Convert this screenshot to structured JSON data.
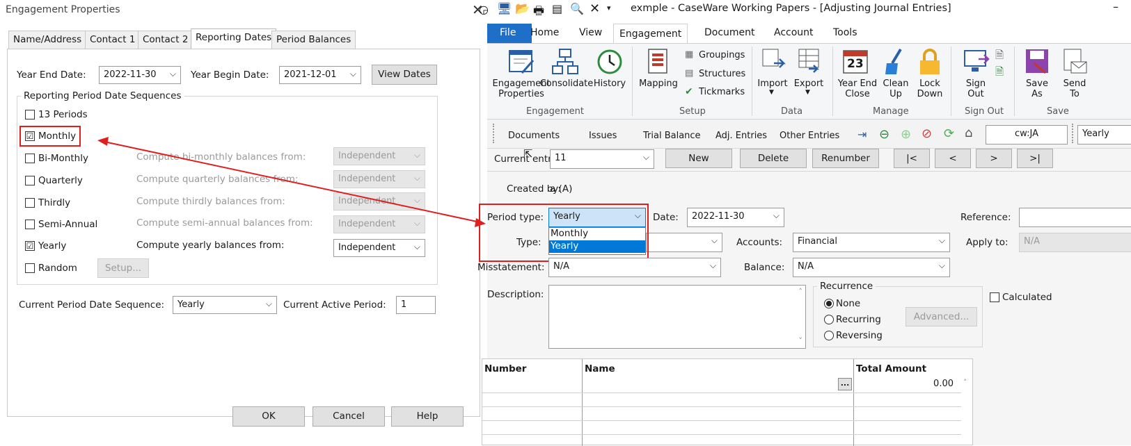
{
  "dialog": {
    "title": "Engagement Properties",
    "close_icon": "close-icon",
    "tabs": [
      "Name/Address",
      "Contact 1",
      "Contact 2",
      "Reporting Dates",
      "Period Balances"
    ],
    "active_tab": "Reporting Dates",
    "year_end_label": "Year End Date:",
    "year_end_value": "2022-11-30",
    "year_begin_label": "Year Begin Date:",
    "year_begin_value": "2021-12-01",
    "view_dates_button": "View Dates",
    "group_title": "Reporting Period Date Sequences",
    "periods": [
      {
        "label": "13 Periods",
        "checked": false
      },
      {
        "label": "Monthly",
        "checked": true
      },
      {
        "label": "Bi-Monthly",
        "checked": false,
        "compute": "Compute bi-monthly balances from:",
        "value": "Independent",
        "enabled": false
      },
      {
        "label": "Quarterly",
        "checked": false,
        "compute": "Compute quarterly balances from:",
        "value": "Independent",
        "enabled": false
      },
      {
        "label": "Thirdly",
        "checked": false,
        "compute": "Compute thirdly balances from:",
        "value": "Independent",
        "enabled": false
      },
      {
        "label": "Semi-Annual",
        "checked": false,
        "compute": "Compute semi-annual balances from:",
        "value": "Independent",
        "enabled": false
      },
      {
        "label": "Yearly",
        "checked": true,
        "compute": "Compute yearly balances from:",
        "value": "Independent",
        "enabled": true
      },
      {
        "label": "Random",
        "checked": false
      }
    ],
    "setup_button": "Setup...",
    "current_seq_label": "Current Period Date Sequence:",
    "current_seq_value": "Yearly",
    "current_active_label": "Current Active Period:",
    "current_active_value": "1",
    "ok_button": "OK",
    "cancel_button": "Cancel",
    "help_button": "Help",
    "check_mark": "☑"
  },
  "app": {
    "title": "exmple - CaseWare Working Papers - [Adjusting Journal Entries]",
    "minimize": "–",
    "ribbon_tabs": [
      "File",
      "Home",
      "View",
      "Engagement",
      "Document",
      "Account",
      "Tools"
    ],
    "active_ribbon_tab": "Engagement",
    "ribbon": {
      "engagement_properties": "Engagement Properties",
      "consolidate": "Consolidate",
      "history": "History",
      "engagement_group": "Engagement",
      "mapping": "Mapping",
      "groupings": "Groupings",
      "structures": "Structures",
      "tickmarks": "Tickmarks",
      "setup_group": "Setup",
      "import": "Import",
      "export": "Export",
      "data_group": "Data",
      "year_end_close": "Year End Close",
      "clean_up": "Clean Up",
      "lock_down": "Lock Down",
      "manage_group": "Manage",
      "sign_out": "Sign Out",
      "sign_out_group": "Sign Out",
      "save_as": "Save As",
      "send_to": "Send To",
      "save_group": "Save",
      "calendar_day": "23"
    },
    "nav": [
      "Documents",
      "Issues",
      "Trial Balance",
      "Adj. Entries",
      "Other Entries"
    ],
    "nav_search": "cw:JA",
    "nav_period": "Yearly",
    "form": {
      "current_entry_label": "Current entry:",
      "current_entry_value": "11",
      "new_button": "New",
      "delete_button": "Delete",
      "renumber_button": "Renumber",
      "first_button": "|<",
      "prev_button": "<",
      "next_button": ">",
      "last_button": ">|",
      "created_by_label": "Created by:",
      "created_by_value": "a (A)",
      "period_type_label": "Period type:",
      "period_type_value": "Yearly",
      "period_options": [
        "Monthly",
        "Yearly"
      ],
      "date_label": "Date:",
      "date_value": "2022-11-30",
      "reference_label": "Reference:",
      "type_label": "Type:",
      "accounts_label": "Accounts:",
      "accounts_value": "Financial",
      "apply_to_label": "Apply to:",
      "apply_to_value": "N/A",
      "misstatement_label": "Misstatement:",
      "misstatement_value": "N/A",
      "balance_label": "Balance:",
      "balance_value": "N/A",
      "description_label": "Description:",
      "recurrence_title": "Recurrence",
      "recurrence": [
        "None",
        "Recurring",
        "Reversing"
      ],
      "advanced_button": "Advanced...",
      "calculated_label": "Calculated",
      "grid_headers": [
        "Number",
        "Name",
        "Total Amount"
      ],
      "grid_amount": "0.00",
      "grid_ellipsis": "..."
    }
  },
  "colors": {
    "accent": "#1e6fc8",
    "highlight_red": "#e01e1e",
    "selected": "#0078d7"
  }
}
